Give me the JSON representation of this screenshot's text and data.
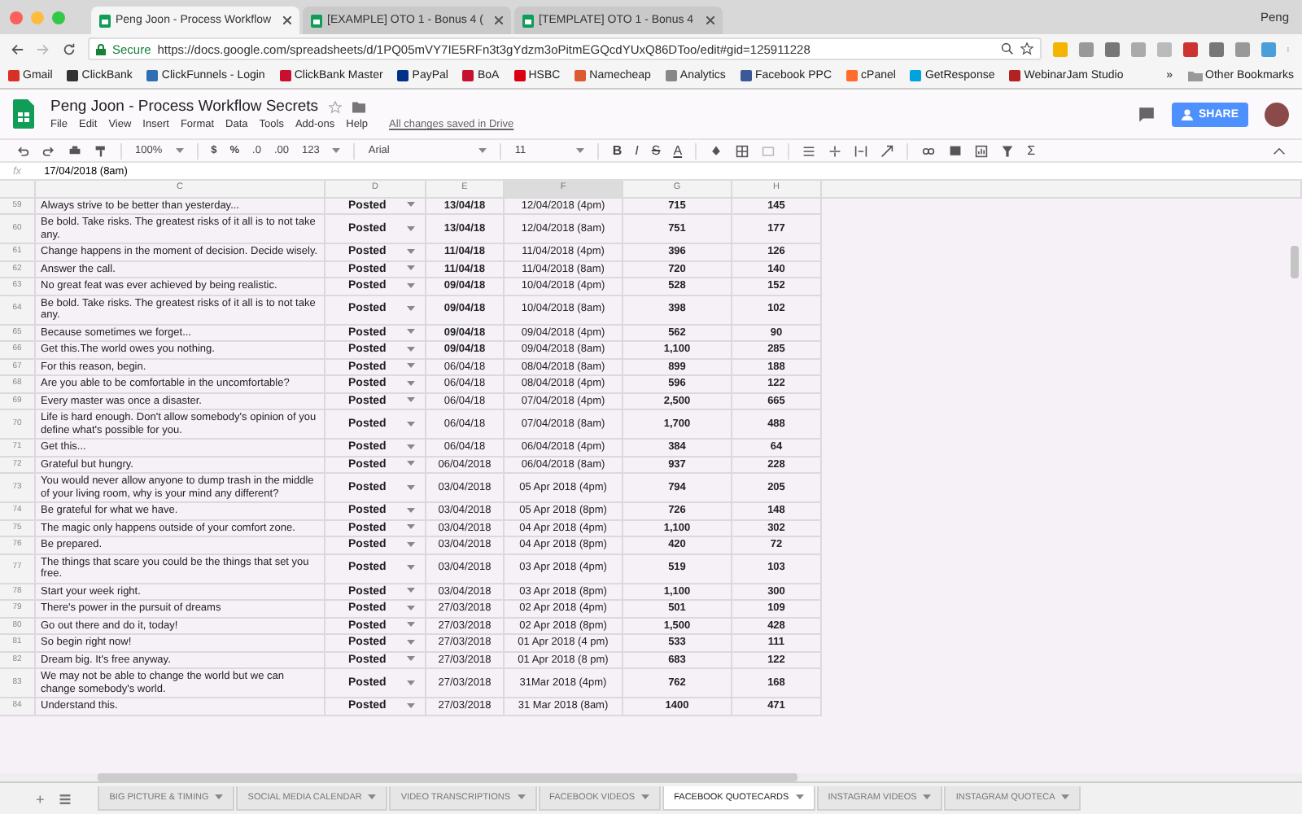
{
  "browser": {
    "tabs": [
      {
        "title": "Peng Joon - Process Workflow",
        "selected": true
      },
      {
        "title": "[EXAMPLE] OTO 1 - Bonus 4 (",
        "selected": false
      },
      {
        "title": "[TEMPLATE] OTO 1 - Bonus 4",
        "selected": false
      }
    ],
    "user": "Peng",
    "secure_label": "Secure",
    "url": "https://docs.google.com/spreadsheets/d/1PQ05mVY7IE5RFn3t3gYdzm3oPitmEGQcdYUxQ86DToo/edit#gid=125911228",
    "bookmarks": [
      {
        "label": "Gmail",
        "color": "#d93025"
      },
      {
        "label": "ClickBank",
        "color": "#333333"
      },
      {
        "label": "ClickFunnels - Login",
        "color": "#2f6eb5"
      },
      {
        "label": "ClickBank Master",
        "color": "#c8102e"
      },
      {
        "label": "PayPal",
        "color": "#003087"
      },
      {
        "label": "BoA",
        "color": "#c41230"
      },
      {
        "label": "HSBC",
        "color": "#db0011"
      },
      {
        "label": "Namecheap",
        "color": "#de5833"
      },
      {
        "label": "Analytics",
        "color": "#888888"
      },
      {
        "label": "Facebook PPC",
        "color": "#3b5998"
      },
      {
        "label": "cPanel",
        "color": "#ff6c2c"
      },
      {
        "label": "GetResponse",
        "color": "#00a2e0"
      },
      {
        "label": "WebinarJam Studio",
        "color": "#b22222"
      }
    ],
    "more": "»",
    "other_bookmarks": "Other Bookmarks"
  },
  "document": {
    "title": "Peng Joon - Process Workflow Secrets",
    "menu": [
      "File",
      "Edit",
      "View",
      "Insert",
      "Format",
      "Data",
      "Tools",
      "Add-ons",
      "Help"
    ],
    "save_status": "All changes saved in Drive",
    "share": "SHARE"
  },
  "toolbar": {
    "zoom": "100%",
    "number_formats": [
      "$",
      "%",
      ".0",
      ".00",
      "123"
    ],
    "font": "Arial",
    "font_size": "11",
    "text_styles": [
      "B",
      "I",
      "S",
      "A"
    ],
    "sum": "Σ"
  },
  "formula_bar": {
    "label": "fx",
    "value": "17/04/2018 (8am)"
  },
  "table": {
    "columns": [
      {
        "label": "C",
        "selected": false
      },
      {
        "label": "D",
        "selected": false
      },
      {
        "label": "E",
        "selected": false
      },
      {
        "label": "F",
        "selected": true
      },
      {
        "label": "G",
        "selected": false
      },
      {
        "label": "H",
        "selected": false
      }
    ],
    "rows": [
      {
        "num": "59",
        "quote": "Always strive to be better than yesterday...",
        "status": "Posted",
        "date": "13/04/18",
        "date_bold": true,
        "post_time": "12/04/2018 (4pm)",
        "col_g": "715",
        "col_h": "145"
      },
      {
        "num": "60",
        "quote": "Be bold. Take risks. The greatest risks of it all is to not take any.",
        "status": "Posted",
        "date": "13/04/18",
        "date_bold": true,
        "post_time": "12/04/2018 (8am)",
        "col_g": "751",
        "col_h": "177"
      },
      {
        "num": "61",
        "quote": "Change happens in the moment of decision. Decide wisely.",
        "status": "Posted",
        "date": "11/04/18",
        "date_bold": true,
        "post_time": "11/04/2018 (4pm)",
        "col_g": "396",
        "col_h": "126"
      },
      {
        "num": "62",
        "quote": "Answer the call.",
        "status": "Posted",
        "date": "11/04/18",
        "date_bold": true,
        "post_time": "11/04/2018 (8am)",
        "col_g": "720",
        "col_h": "140"
      },
      {
        "num": "63",
        "quote": "No great feat was ever achieved by being realistic.",
        "status": "Posted",
        "date": "09/04/18",
        "date_bold": true,
        "post_time": "10/04/2018 (4pm)",
        "col_g": "528",
        "col_h": "152"
      },
      {
        "num": "64",
        "quote": "Be bold. Take risks. The greatest risks of it all is to not take any.",
        "status": "Posted",
        "date": "09/04/18",
        "date_bold": true,
        "post_time": "10/04/2018 (8am)",
        "col_g": "398",
        "col_h": "102"
      },
      {
        "num": "65",
        "quote": "Because sometimes we forget...",
        "status": "Posted",
        "date": "09/04/18",
        "date_bold": true,
        "post_time": "09/04/2018 (4pm)",
        "col_g": "562",
        "col_h": "90"
      },
      {
        "num": "66",
        "quote": "Get this.The world owes you nothing.",
        "status": "Posted",
        "date": "09/04/18",
        "date_bold": true,
        "post_time": "09/04/2018 (8am)",
        "col_g": "1,100",
        "col_h": "285"
      },
      {
        "num": "67",
        "quote": "For this reason, begin.",
        "status": "Posted",
        "date": "06/04/18",
        "date_bold": false,
        "post_time": "08/04/2018 (8am)",
        "col_g": "899",
        "col_h": "188"
      },
      {
        "num": "68",
        "quote": "Are you able to be comfortable in the uncomfortable?",
        "status": "Posted",
        "date": "06/04/18",
        "date_bold": false,
        "post_time": "08/04/2018 (4pm)",
        "col_g": "596",
        "col_h": "122"
      },
      {
        "num": "69",
        "quote": "Every master was once a disaster.",
        "status": "Posted",
        "date": "06/04/18",
        "date_bold": false,
        "post_time": "07/04/2018 (4pm)",
        "col_g": "2,500",
        "col_h": "665"
      },
      {
        "num": "70",
        "quote": "Life is hard enough. Don't allow somebody's opinion of you define what's possible for you.",
        "status": "Posted",
        "date": "06/04/18",
        "date_bold": false,
        "post_time": "07/04/2018 (8am)",
        "col_g": "1,700",
        "col_h": "488"
      },
      {
        "num": "71",
        "quote": "Get this...",
        "status": "Posted",
        "date": "06/04/18",
        "date_bold": false,
        "post_time": "06/04/2018 (4pm)",
        "col_g": "384",
        "col_h": "64"
      },
      {
        "num": "72",
        "quote": "Grateful but hungry.",
        "status": "Posted",
        "date": "06/04/2018",
        "date_bold": false,
        "post_time": "06/04/2018 (8am)",
        "col_g": "937",
        "col_h": "228"
      },
      {
        "num": "73",
        "quote": "You would never allow anyone to dump trash in the middle of your living room, why is your mind any different?",
        "status": "Posted",
        "date": "03/04/2018",
        "date_bold": false,
        "post_time": "05 Apr 2018 (4pm)",
        "col_g": "794",
        "col_h": "205"
      },
      {
        "num": "74",
        "quote": "Be grateful for what we have.",
        "status": "Posted",
        "date": "03/04/2018",
        "date_bold": false,
        "post_time": "05 Apr 2018 (8pm)",
        "col_g": "726",
        "col_h": "148"
      },
      {
        "num": "75",
        "quote": "The magic only happens outside of your comfort zone.",
        "status": "Posted",
        "date": "03/04/2018",
        "date_bold": false,
        "post_time": "04 Apr 2018 (4pm)",
        "col_g": "1,100",
        "col_h": "302"
      },
      {
        "num": "76",
        "quote": "Be prepared.",
        "status": "Posted",
        "date": "03/04/2018",
        "date_bold": false,
        "post_time": "04 Apr 2018 (8pm)",
        "col_g": "420",
        "col_h": "72"
      },
      {
        "num": "77",
        "quote": "The things that scare you could be the things that set you free.",
        "status": "Posted",
        "date": "03/04/2018",
        "date_bold": false,
        "post_time": "03 Apr 2018 (4pm)",
        "col_g": "519",
        "col_h": "103"
      },
      {
        "num": "78",
        "quote": "Start your week right.",
        "status": "Posted",
        "date": "03/04/2018",
        "date_bold": false,
        "post_time": "03 Apr 2018 (8pm)",
        "col_g": "1,100",
        "col_h": "300"
      },
      {
        "num": "79",
        "quote": "There's power in the pursuit of dreams",
        "status": "Posted",
        "date": "27/03/2018",
        "date_bold": false,
        "post_time": "02 Apr 2018 (4pm)",
        "col_g": "501",
        "col_h": "109"
      },
      {
        "num": "80",
        "quote": "Go out there and do it, today!",
        "status": "Posted",
        "date": "27/03/2018",
        "date_bold": false,
        "post_time": "02 Apr 2018 (8pm)",
        "col_g": "1,500",
        "col_h": "428"
      },
      {
        "num": "81",
        "quote": "So begin right now!",
        "status": "Posted",
        "date": "27/03/2018",
        "date_bold": false,
        "post_time": "01 Apr 2018 (4 pm)",
        "col_g": "533",
        "col_h": "111"
      },
      {
        "num": "82",
        "quote": "Dream big. It's free anyway.",
        "status": "Posted",
        "date": "27/03/2018",
        "date_bold": false,
        "post_time": "01 Apr 2018 (8 pm)",
        "col_g": "683",
        "col_h": "122"
      },
      {
        "num": "83",
        "quote": "We may not be able to change the world but we can change somebody's world.",
        "status": "Posted",
        "date": "27/03/2018",
        "date_bold": false,
        "post_time": "31Mar 2018 (4pm)",
        "col_g": "762",
        "col_h": "168"
      },
      {
        "num": "84",
        "quote": "Understand this.",
        "status": "Posted",
        "date": "27/03/2018",
        "date_bold": false,
        "post_time": "31 Mar 2018 (8am)",
        "col_g": "1400",
        "col_h": "471"
      }
    ]
  },
  "add_sheet": "+",
  "sheet_tabs": [
    {
      "label": "BIG PICTURE & TIMING",
      "selected": false
    },
    {
      "label": "SOCIAL MEDIA CALENDAR",
      "selected": false
    },
    {
      "label": "VIDEO TRANSCRIPTIONS",
      "selected": false
    },
    {
      "label": "FACEBOOK VIDEOS",
      "selected": false
    },
    {
      "label": "FACEBOOK QUOTECARDS",
      "selected": true
    },
    {
      "label": "INSTAGRAM VIDEOS",
      "selected": false
    },
    {
      "label": "INSTAGRAM QUOTECA",
      "selected": false
    }
  ]
}
